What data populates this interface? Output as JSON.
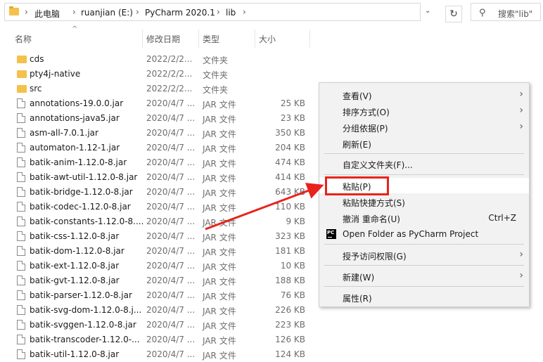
{
  "address": {
    "crumbs": [
      "此电脑",
      "ruanjian (E:)",
      "PyCharm 2020.1",
      "lib"
    ],
    "separator": "›",
    "dropdown_glyph": "⌄",
    "refresh_glyph": "↻"
  },
  "search": {
    "placeholder": "搜索\"lib\""
  },
  "columns": {
    "name": "名称",
    "date": "修改日期",
    "type": "类型",
    "size": "大小"
  },
  "files": [
    {
      "name": "cds",
      "date": "2022/2/2...",
      "type": "文件夹",
      "size": "",
      "kind": "folder"
    },
    {
      "name": "pty4j-native",
      "date": "2022/2/2...",
      "type": "文件夹",
      "size": "",
      "kind": "folder"
    },
    {
      "name": "src",
      "date": "2022/2/2...",
      "type": "文件夹",
      "size": "",
      "kind": "folder"
    },
    {
      "name": "annotations-19.0.0.jar",
      "date": "2020/4/7 ...",
      "type": "JAR 文件",
      "size": "25 KB",
      "kind": "file"
    },
    {
      "name": "annotations-java5.jar",
      "date": "2020/4/7 ...",
      "type": "JAR 文件",
      "size": "23 KB",
      "kind": "file"
    },
    {
      "name": "asm-all-7.0.1.jar",
      "date": "2020/4/7 ...",
      "type": "JAR 文件",
      "size": "350 KB",
      "kind": "file"
    },
    {
      "name": "automaton-1.12-1.jar",
      "date": "2020/4/7 ...",
      "type": "JAR 文件",
      "size": "204 KB",
      "kind": "file"
    },
    {
      "name": "batik-anim-1.12.0-8.jar",
      "date": "2020/4/7 ...",
      "type": "JAR 文件",
      "size": "474 KB",
      "kind": "file"
    },
    {
      "name": "batik-awt-util-1.12.0-8.jar",
      "date": "2020/4/7 ...",
      "type": "JAR 文件",
      "size": "414 KB",
      "kind": "file"
    },
    {
      "name": "batik-bridge-1.12.0-8.jar",
      "date": "2020/4/7 ...",
      "type": "JAR 文件",
      "size": "643 KB",
      "kind": "file"
    },
    {
      "name": "batik-codec-1.12.0-8.jar",
      "date": "2020/4/7 ...",
      "type": "JAR 文件",
      "size": "110 KB",
      "kind": "file"
    },
    {
      "name": "batik-constants-1.12.0-8....",
      "date": "2020/4/7 ...",
      "type": "JAR 文件",
      "size": "9 KB",
      "kind": "file"
    },
    {
      "name": "batik-css-1.12.0-8.jar",
      "date": "2020/4/7 ...",
      "type": "JAR 文件",
      "size": "323 KB",
      "kind": "file"
    },
    {
      "name": "batik-dom-1.12.0-8.jar",
      "date": "2020/4/7 ...",
      "type": "JAR 文件",
      "size": "181 KB",
      "kind": "file"
    },
    {
      "name": "batik-ext-1.12.0-8.jar",
      "date": "2020/4/7 ...",
      "type": "JAR 文件",
      "size": "10 KB",
      "kind": "file"
    },
    {
      "name": "batik-gvt-1.12.0-8.jar",
      "date": "2020/4/7 ...",
      "type": "JAR 文件",
      "size": "188 KB",
      "kind": "file"
    },
    {
      "name": "batik-parser-1.12.0-8.jar",
      "date": "2020/4/7 ...",
      "type": "JAR 文件",
      "size": "76 KB",
      "kind": "file"
    },
    {
      "name": "batik-svg-dom-1.12.0-8.j...",
      "date": "2020/4/7 ...",
      "type": "JAR 文件",
      "size": "226 KB",
      "kind": "file"
    },
    {
      "name": "batik-svggen-1.12.0-8.jar",
      "date": "2020/4/7 ...",
      "type": "JAR 文件",
      "size": "223 KB",
      "kind": "file"
    },
    {
      "name": "batik-transcoder-1.12.0-...",
      "date": "2020/4/7 ...",
      "type": "JAR 文件",
      "size": "126 KB",
      "kind": "file"
    },
    {
      "name": "batik-util-1.12.0-8.jar",
      "date": "2020/4/7 ...",
      "type": "JAR 文件",
      "size": "124 KB",
      "kind": "file"
    }
  ],
  "context_menu": {
    "view": "查看(V)",
    "sort": "排序方式(O)",
    "group": "分组依据(P)",
    "refresh": "刷新(E)",
    "customize": "自定义文件夹(F)...",
    "paste": "粘贴(P)",
    "paste_shortcut": "粘贴快捷方式(S)",
    "undo": "撤消 重命名(U)",
    "undo_key": "Ctrl+Z",
    "open_pycharm": "Open Folder as PyCharm Project",
    "pycharm_icon_text": "PC",
    "grant_access": "授予访问权限(G)",
    "new": "新建(W)",
    "properties": "属性(R)",
    "submenu_arrow": "›"
  },
  "annotation": {
    "color": "#e8231b"
  }
}
